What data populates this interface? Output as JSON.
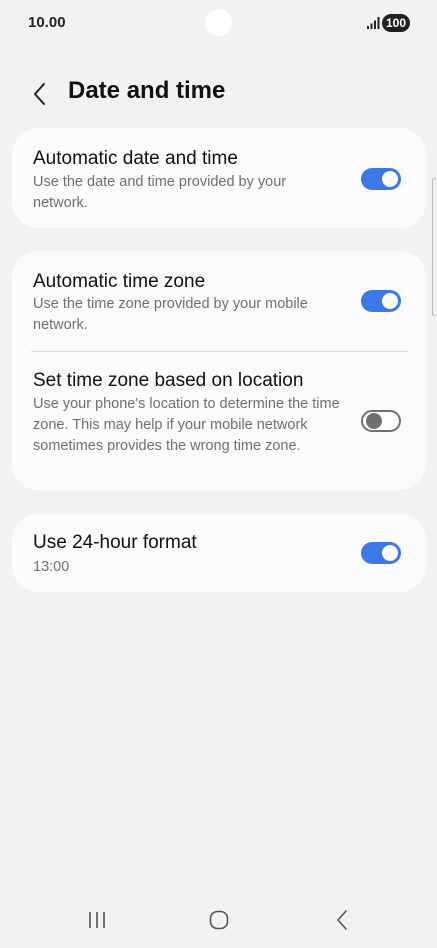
{
  "status_bar": {
    "time": "10.00",
    "battery": "100"
  },
  "header": {
    "title": "Date and time"
  },
  "settings": {
    "auto_date_time": {
      "title": "Automatic date and time",
      "subtitle": "Use the date and time provided by your network.",
      "enabled": true
    },
    "auto_time_zone": {
      "title": "Automatic time zone",
      "subtitle": "Use the time zone provided by your mobile network.",
      "enabled": true
    },
    "location_time_zone": {
      "title": "Set time zone based on location",
      "subtitle": "Use your phone's location to determine the time zone. This may help if your mobile network sometimes provides the wrong time zone.",
      "enabled": false
    },
    "hour_format": {
      "title": "Use 24-hour format",
      "subtitle": "13:00",
      "enabled": true
    }
  },
  "colors": {
    "background": "#f2f2f4",
    "card": "#fbfbfd",
    "toggle_on": "#3e78e8",
    "toggle_off": "#707070"
  },
  "icons": {
    "back": "chevron-left-icon",
    "signal": "signal-icon",
    "nav_recents": "recent-apps-icon",
    "nav_home": "home-icon",
    "nav_back": "back-icon"
  }
}
